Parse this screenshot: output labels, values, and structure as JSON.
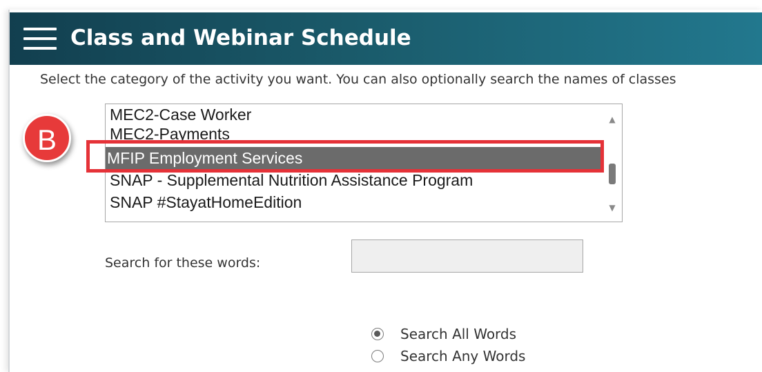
{
  "header": {
    "title": "Class and Webinar Schedule",
    "menu_icon": "hamburger-menu-icon"
  },
  "instructions": "Select the category of the activity you want. You can also optionally search the names of classes",
  "category_list": {
    "items": [
      {
        "label": "MEC2-Case Worker",
        "selected": false
      },
      {
        "label": "MEC2-Payments",
        "selected": false
      },
      {
        "label": "MFIP Employment Services",
        "selected": true
      },
      {
        "label": "SNAP - Supplemental Nutrition Assistance Program",
        "selected": false
      },
      {
        "label": "SNAP #StayatHomeEdition",
        "selected": false
      }
    ],
    "selected_value": "MFIP Employment Services"
  },
  "step_badge": {
    "label": "B",
    "color": "#e73a3a"
  },
  "highlight_color": "#e53238",
  "search": {
    "label": "Search for these words:",
    "value": "",
    "placeholder": ""
  },
  "search_mode": {
    "options": [
      {
        "label": "Search All Words",
        "checked": true
      },
      {
        "label": "Search Any Words",
        "checked": false
      }
    ]
  },
  "colors": {
    "header_gradient_start": "#123f4f",
    "header_gradient_end": "#22788e",
    "selected_item_bg": "#6b6b6b"
  }
}
